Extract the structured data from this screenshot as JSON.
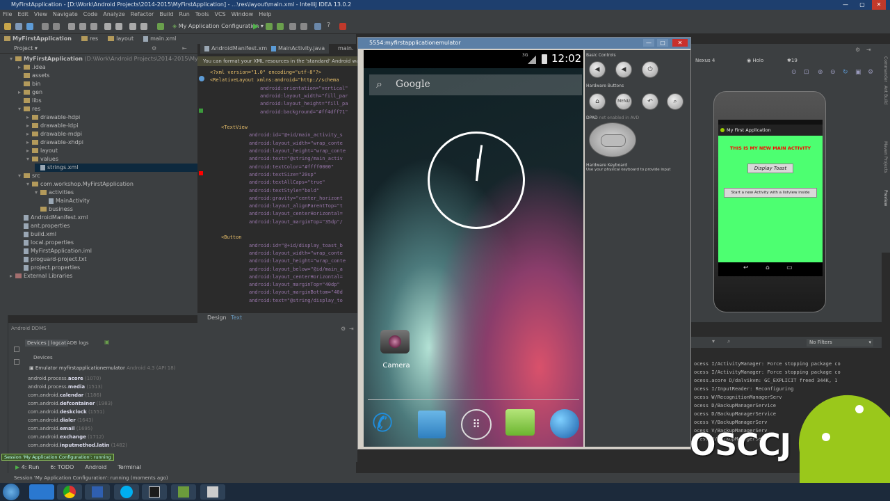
{
  "window": {
    "title": "MyFirstApplication - [D:\\Work\\Android Projects\\2014-2015\\MyFirstApplication] - ...\\res\\layout\\main.xml - IntelliJ IDEA 13.0.2"
  },
  "menu": [
    "File",
    "Edit",
    "View",
    "Navigate",
    "Code",
    "Analyze",
    "Refactor",
    "Build",
    "Run",
    "Tools",
    "VCS",
    "Window",
    "Help"
  ],
  "toolbar": {
    "run_config": "My Application Configuration"
  },
  "breadcrumb": [
    "MyFirstApplication",
    "res",
    "layout",
    "main.xml"
  ],
  "project_panel": {
    "header": "Project",
    "root": "MyFirstApplication",
    "root_path": "(D:\\Work\\Android Projects\\2014-2015\\MyFirstApplication",
    "items": [
      {
        "label": ".idea",
        "depth": 1,
        "type": "folder",
        "arrow": "▸"
      },
      {
        "label": "assets",
        "depth": 1,
        "type": "folder",
        "arrow": ""
      },
      {
        "label": "bin",
        "depth": 1,
        "type": "folder",
        "arrow": ""
      },
      {
        "label": "gen",
        "depth": 1,
        "type": "folder",
        "arrow": "▸"
      },
      {
        "label": "libs",
        "depth": 1,
        "type": "folder",
        "arrow": ""
      },
      {
        "label": "res",
        "depth": 1,
        "type": "folder",
        "arrow": "▾"
      },
      {
        "label": "drawable-hdpi",
        "depth": 2,
        "type": "folder",
        "arrow": "▸"
      },
      {
        "label": "drawable-ldpi",
        "depth": 2,
        "type": "folder",
        "arrow": "▸"
      },
      {
        "label": "drawable-mdpi",
        "depth": 2,
        "type": "folder",
        "arrow": "▸"
      },
      {
        "label": "drawable-xhdpi",
        "depth": 2,
        "type": "folder",
        "arrow": "▸"
      },
      {
        "label": "layout",
        "depth": 2,
        "type": "folder",
        "arrow": "▸"
      },
      {
        "label": "values",
        "depth": 2,
        "type": "folder",
        "arrow": "▾"
      },
      {
        "label": "strings.xml",
        "depth": 3,
        "type": "file",
        "arrow": "",
        "selected": true
      },
      {
        "label": "src",
        "depth": 1,
        "type": "folder",
        "arrow": "▾"
      },
      {
        "label": "com.workshop.MyFirstApplication",
        "depth": 2,
        "type": "folder",
        "arrow": "▾"
      },
      {
        "label": "activities",
        "depth": 3,
        "type": "folder",
        "arrow": "▾"
      },
      {
        "label": "MainActivity",
        "depth": 4,
        "type": "file",
        "arrow": ""
      },
      {
        "label": "business",
        "depth": 3,
        "type": "folder",
        "arrow": ""
      },
      {
        "label": "AndroidManifest.xml",
        "depth": 1,
        "type": "file",
        "arrow": ""
      },
      {
        "label": "ant.properties",
        "depth": 1,
        "type": "file",
        "arrow": ""
      },
      {
        "label": "build.xml",
        "depth": 1,
        "type": "file",
        "arrow": ""
      },
      {
        "label": "local.properties",
        "depth": 1,
        "type": "file",
        "arrow": ""
      },
      {
        "label": "MyFirstApplication.iml",
        "depth": 1,
        "type": "file",
        "arrow": ""
      },
      {
        "label": "proguard-project.txt",
        "depth": 1,
        "type": "file",
        "arrow": ""
      },
      {
        "label": "project.properties",
        "depth": 1,
        "type": "file",
        "arrow": ""
      }
    ],
    "external": "External Libraries"
  },
  "editor": {
    "tabs": [
      "AndroidManifest.xml",
      "MainActivity.java",
      "main."
    ],
    "notice": "You can format your XML resources in the 'standard' Android way. C",
    "lines": [
      {
        "t": "<?xml version=\"1.0\" encoding=\"utf-8\"?>",
        "c": "tag",
        "i": 0
      },
      {
        "t": "<RelativeLayout xmlns:android=\"http://schema",
        "c": "tag",
        "i": 0
      },
      {
        "t": "android:orientation=\"vertical\"",
        "c": "attr",
        "i": 9
      },
      {
        "t": "android:layout_width=\"fill_par",
        "c": "attr",
        "i": 9
      },
      {
        "t": "android:layout_height=\"fill_pa",
        "c": "attr",
        "i": 9
      },
      {
        "t": "android:background=\"#ff4dff71\"",
        "c": "attr",
        "i": 9
      },
      {
        "t": "",
        "c": "attr",
        "i": 0
      },
      {
        "t": "<TextView",
        "c": "tag",
        "i": 2
      },
      {
        "t": "android:id=\"@+id/main_activity_s",
        "c": "attr",
        "i": 7
      },
      {
        "t": "android:layout_width=\"wrap_conte",
        "c": "attr",
        "i": 7
      },
      {
        "t": "android:layout_height=\"wrap_conte",
        "c": "attr",
        "i": 7
      },
      {
        "t": "android:text=\"@string/main_activ",
        "c": "attr",
        "i": 7
      },
      {
        "t": "android:textColor=\"#ffff0000\"",
        "c": "attr",
        "i": 7
      },
      {
        "t": "android:textSize=\"20sp\"",
        "c": "attr",
        "i": 7
      },
      {
        "t": "android:textAllCaps=\"true\"",
        "c": "attr",
        "i": 7
      },
      {
        "t": "android:textStyle=\"bold\"",
        "c": "attr",
        "i": 7
      },
      {
        "t": "android:gravity=\"center_horizont",
        "c": "attr",
        "i": 7
      },
      {
        "t": "android:layout_alignParentTop=\"t",
        "c": "attr",
        "i": 7
      },
      {
        "t": "android:layout_centerHorizontal=",
        "c": "attr",
        "i": 7
      },
      {
        "t": "android:layout_marginTop=\"35dp\"/",
        "c": "attr",
        "i": 7
      },
      {
        "t": "",
        "c": "attr",
        "i": 0
      },
      {
        "t": "<Button",
        "c": "tag",
        "i": 2
      },
      {
        "t": "android:id=\"@+id/display_toast_b",
        "c": "attr",
        "i": 7
      },
      {
        "t": "android:layout_width=\"wrap_conte",
        "c": "attr",
        "i": 7
      },
      {
        "t": "android:layout_height=\"wrap_conte",
        "c": "attr",
        "i": 7
      },
      {
        "t": "android:layout_below=\"@id/main_a",
        "c": "attr",
        "i": 7
      },
      {
        "t": "android:layout_centerHorizontal=",
        "c": "attr",
        "i": 7
      },
      {
        "t": "android:layout_marginTop=\"40dp\"",
        "c": "attr",
        "i": 7
      },
      {
        "t": "android:layout_marginBottom=\"40d",
        "c": "attr",
        "i": 7
      },
      {
        "t": "android:text=\"@string/display_to",
        "c": "attr",
        "i": 7
      }
    ],
    "design_tab": "Design",
    "text_tab": "Text"
  },
  "ddms": {
    "header": "Android DDMS",
    "tab_devices": "Devices | logcat",
    "tab_adb": "ADB logs",
    "devices_label": "Devices",
    "emulator": "Emulator myfirstapplicationemulator",
    "emulator_version": "Android 4.3 (API 18)",
    "processes": [
      {
        "pre": "android.process.",
        "bold": "acore",
        "pid": "(1070)"
      },
      {
        "pre": "android.process.",
        "bold": "media",
        "pid": "(1513)"
      },
      {
        "pre": "com.android.",
        "bold": "calendar",
        "pid": "(1186)"
      },
      {
        "pre": "com.android.",
        "bold": "defcontainer",
        "pid": "(1983)"
      },
      {
        "pre": "com.android.",
        "bold": "deskclock",
        "pid": "(1551)"
      },
      {
        "pre": "com.android.",
        "bold": "dialer",
        "pid": "(1643)"
      },
      {
        "pre": "com.android.",
        "bold": "email",
        "pid": "(1695)"
      },
      {
        "pre": "com.android.",
        "bold": "exchange",
        "pid": "(1712)"
      },
      {
        "pre": "com.android.",
        "bold": "inputmethod.latin",
        "pid": "(1482)"
      }
    ],
    "session_badge": "Session 'My Application Configuration': running"
  },
  "bottom_tabs": [
    "4: Run",
    "6: TODO",
    "Android",
    "Terminal"
  ],
  "status": "Session 'My Application Configuration': running (moments ago)",
  "emulator": {
    "title": "5554:myfirstapplicationemulator",
    "clock": "12:02",
    "signal": "3G",
    "search": "Google",
    "camera_label": "Camera",
    "controls": {
      "basic": "Basic Controls",
      "hardware": "Hardware Buttons",
      "menu_btn": "MENU",
      "dpad": "DPAD",
      "dpad_note": "not enabled in AVD",
      "keyboard": "Hardware Keyboard",
      "keyboard_note": "Use your physical keyboard to provide input"
    }
  },
  "preview": {
    "device": "Nexus 4",
    "theme": "Holo",
    "api": "19",
    "app_title": "My First Application",
    "main_text": "THIS IS MY NEW MAIN ACTIVITY",
    "toast_btn": "Display Toast",
    "list_btn": "Start a new Activity with a listview inside",
    "accent": "#4dff71"
  },
  "logcat": {
    "filter": "No Filters",
    "lines": [
      "ocess I/ActivityManager:  Force stopping package co",
      "ocess I/ActivityManager:  Force stopping package co",
      "ocess.acore D/dalvikvm:  GC_EXPLICIT freed 344K, 1",
      "ocess I/InputReader:  Reconfiguring",
      "ocess W/RecognitionManagerServ",
      "ocess D/BackupManagerService",
      "ocess D/BackupManagerService",
      "ocess V/BackupManagerServ",
      "ocess V/BackupManagerServ",
      "ocess V/BackupManagerServ"
    ]
  },
  "watermark": "OSCCJ",
  "right_strip_labels": [
    "Commander",
    "Ant Build",
    "Maven Projects",
    "Preview"
  ]
}
